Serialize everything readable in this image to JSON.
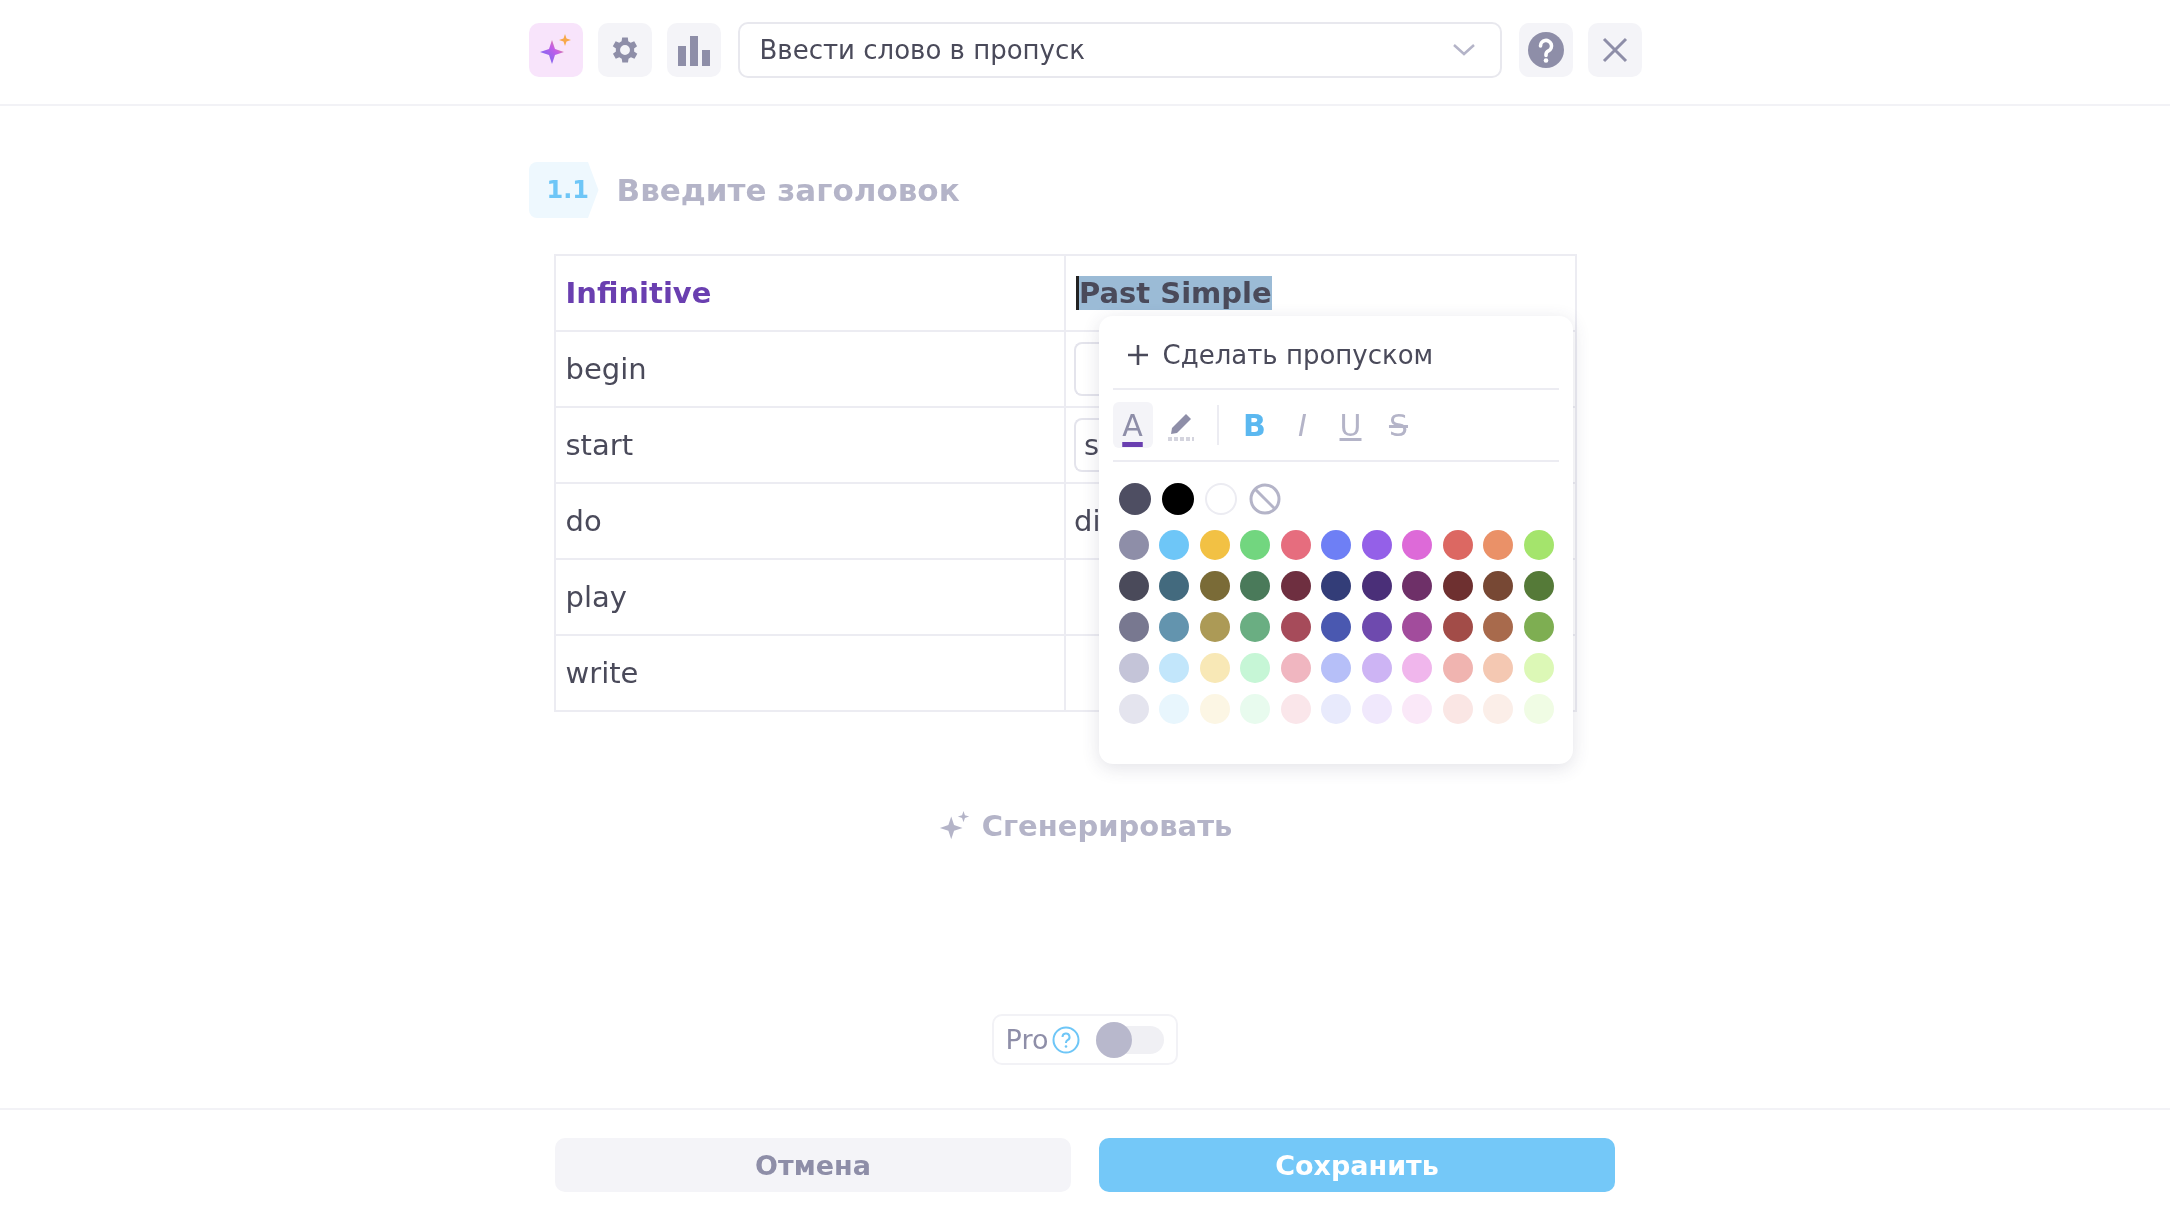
{
  "toolbar": {
    "mode": "Ввести слово в пропуск"
  },
  "task": {
    "number": "1.1",
    "title_placeholder": "Введите заголовок"
  },
  "table": {
    "columns": [
      {
        "label": "Infinitive",
        "highlighted": false
      },
      {
        "label": "Past Simple",
        "highlighted": true
      }
    ],
    "rows": [
      {
        "infinitive": "begin",
        "past": {
          "kind": "field"
        }
      },
      {
        "infinitive": "start",
        "past": {
          "kind": "field",
          "value": "s"
        }
      },
      {
        "infinitive": "do",
        "past": {
          "kind": "text",
          "value": "di"
        }
      },
      {
        "infinitive": "play",
        "past": {
          "kind": "empty"
        }
      },
      {
        "infinitive": "write",
        "past": {
          "kind": "empty"
        }
      }
    ]
  },
  "popup": {
    "action": "Сделать пропуском",
    "formats": [
      {
        "kind": "text-color",
        "glyph": "A",
        "active": true
      },
      {
        "kind": "highlight",
        "active": false
      },
      {
        "kind": "bold",
        "glyph": "B",
        "active": true
      },
      {
        "kind": "italic",
        "glyph": "I",
        "active": false
      },
      {
        "kind": "underline",
        "glyph": "U",
        "active": false
      },
      {
        "kind": "strike",
        "glyph": "S",
        "active": false
      }
    ],
    "base_colors": [
      {
        "kind": "swatch",
        "color": "#4e4e62"
      },
      {
        "kind": "swatch",
        "color": "#000000"
      },
      {
        "kind": "swatch",
        "color": "#ffffff"
      },
      {
        "kind": "none"
      }
    ],
    "palette": [
      [
        {
          "color": "#8e8ea8"
        },
        {
          "color": "#6ec6f7"
        },
        {
          "color": "#f2c144"
        },
        {
          "color": "#72d67f"
        },
        {
          "color": "#e66d7e"
        },
        {
          "color": "#6e7ff5"
        },
        {
          "color": "#9460e8"
        },
        {
          "color": "#dd6ad8"
        },
        {
          "color": "#dc6862"
        },
        {
          "color": "#ea9168"
        },
        {
          "color": "#a4e46c"
        }
      ],
      [
        {
          "color": "#4a4a5a"
        },
        {
          "color": "#436a7e"
        },
        {
          "color": "#7a6b37"
        },
        {
          "color": "#4a7a5a"
        },
        {
          "color": "#6e2f40"
        },
        {
          "color": "#333d78"
        },
        {
          "color": "#4a2f78"
        },
        {
          "color": "#6e3068"
        },
        {
          "color": "#6e3030"
        },
        {
          "color": "#774834"
        },
        {
          "color": "#557a38"
        }
      ],
      [
        {
          "color": "#787890"
        },
        {
          "color": "#6394ae"
        },
        {
          "color": "#ac9a56"
        },
        {
          "color": "#6aae82"
        },
        {
          "color": "#a64b5a"
        },
        {
          "color": "#4a58b0"
        },
        {
          "color": "#6e4aae"
        },
        {
          "color": "#a24c9c"
        },
        {
          "color": "#a24c48"
        },
        {
          "color": "#a86a4c"
        },
        {
          "color": "#7eae52"
        }
      ],
      [
        {
          "color": "#c4c4d8"
        },
        {
          "color": "#c2e6fb"
        },
        {
          "color": "#f8e8b6"
        },
        {
          "color": "#c6f6d6"
        },
        {
          "color": "#f0b6c0"
        },
        {
          "color": "#b6bff8"
        },
        {
          "color": "#cdb4f4"
        },
        {
          "color": "#f0b6ec"
        },
        {
          "color": "#f0b4b0"
        },
        {
          "color": "#f4c8b2"
        },
        {
          "color": "#dcf8b6"
        }
      ],
      [
        {
          "color": "#e4e4ee"
        },
        {
          "color": "#e8f6fd"
        },
        {
          "color": "#fcf6e4"
        },
        {
          "color": "#e8fbee"
        },
        {
          "color": "#fae6ea"
        },
        {
          "color": "#e8eafc"
        },
        {
          "color": "#f0e8fc"
        },
        {
          "color": "#fae8f8"
        },
        {
          "color": "#fae6e4"
        },
        {
          "color": "#fbeee8"
        },
        {
          "color": "#f0fce4"
        }
      ]
    ]
  },
  "generate": {
    "label": "Сгенерировать"
  },
  "pro": {
    "label": "Pro",
    "on": false
  },
  "footer": {
    "cancel": "Отмена",
    "save": "Сохранить"
  }
}
